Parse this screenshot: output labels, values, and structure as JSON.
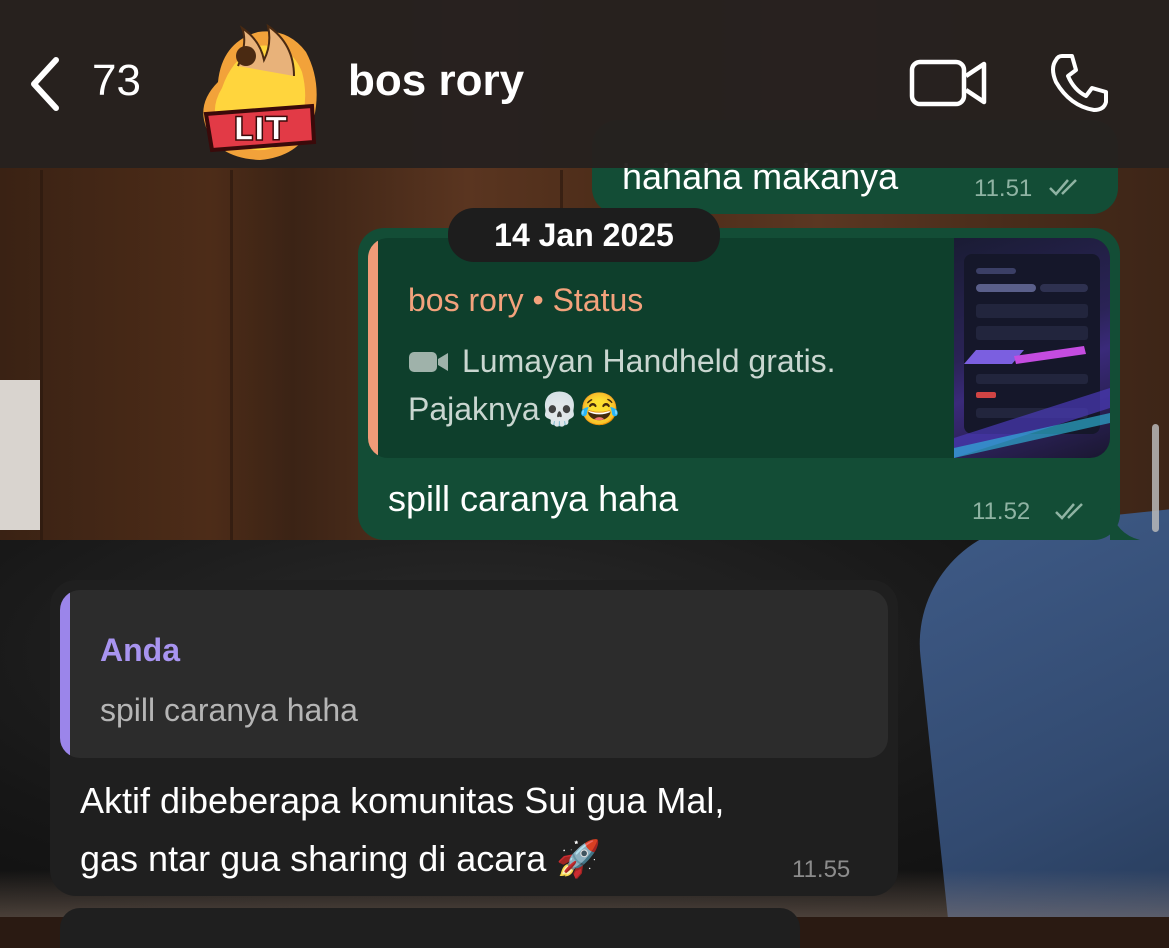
{
  "header": {
    "back_count": "73",
    "contact_name": "bos rory",
    "avatar_text": "LIT",
    "icons": {
      "back": "chevron-left-icon",
      "video": "video-camera-icon",
      "call": "phone-icon"
    }
  },
  "messages": {
    "prev": {
      "text": "hahaha makanya",
      "time": "11.51"
    },
    "date_separator": "14 Jan 2025",
    "reply_out": {
      "quote_name": "bos rory • Status",
      "quote_line1": "Lumayan Handheld gratis.",
      "quote_line2": "Pajaknya💀😂",
      "text": "spill caranya haha",
      "time": "11.52"
    },
    "reply_in": {
      "quote_name": "Anda",
      "quote_text": "spill caranya haha",
      "line1": "Aktif dibeberapa komunitas Sui gua Mal,",
      "line2": "gas ntar gua sharing di acara 🚀",
      "time": "11.55"
    }
  },
  "colors": {
    "outgoing_bubble": "#134d36",
    "incoming_bubble": "#1f1f1f",
    "status_quote_accent": "#f09b78",
    "self_quote_accent": "#9b85ea"
  }
}
